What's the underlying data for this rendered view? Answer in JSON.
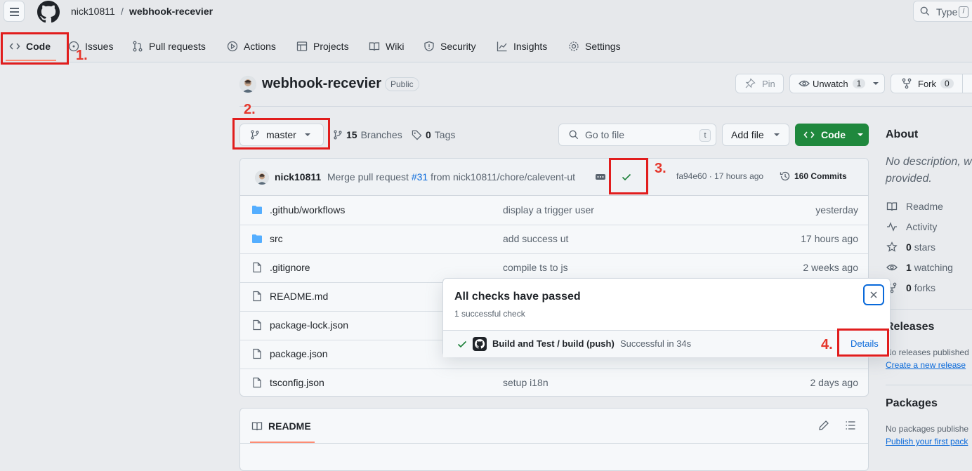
{
  "header": {
    "owner": "nick10811",
    "separator": "/",
    "repo": "webhook-recevier",
    "search_placeholder": "Type",
    "search_kbd": "/"
  },
  "tabs": [
    {
      "label": "Code",
      "icon": "code-icon"
    },
    {
      "label": "Issues",
      "icon": "issue-icon"
    },
    {
      "label": "Pull requests",
      "icon": "pull-request-icon"
    },
    {
      "label": "Actions",
      "icon": "play-icon"
    },
    {
      "label": "Projects",
      "icon": "table-icon"
    },
    {
      "label": "Wiki",
      "icon": "book-icon"
    },
    {
      "label": "Security",
      "icon": "shield-icon"
    },
    {
      "label": "Insights",
      "icon": "graph-icon"
    },
    {
      "label": "Settings",
      "icon": "gear-icon"
    }
  ],
  "annotations": {
    "step1": "1.",
    "step2": "2.",
    "step3": "3.",
    "step4": "4."
  },
  "repo": {
    "title": "webhook-recevier",
    "visibility": "Public",
    "pin_label": "Pin",
    "unwatch_label": "Unwatch",
    "watch_count": "1",
    "fork_label": "Fork",
    "fork_count": "0"
  },
  "branchbar": {
    "branch": "master",
    "branches_count": "15",
    "branches_label": "Branches",
    "tags_count": "0",
    "tags_label": "Tags",
    "goto_placeholder": "Go to file",
    "goto_kbd": "t",
    "addfile_label": "Add file",
    "code_label": "Code"
  },
  "commit": {
    "author": "nick10811",
    "message_prefix": "Merge pull request",
    "pr_link": "#31",
    "message_suffix": "from nick10811/chore/calevent-ut",
    "hash_time": "fa94e60 · 17 hours ago",
    "commits_label": "160 Commits"
  },
  "files": [
    {
      "type": "dir",
      "name": ".github/workflows",
      "message": "display a trigger user",
      "date": "yesterday"
    },
    {
      "type": "dir",
      "name": "src",
      "message": "add success ut",
      "date": "17 hours ago"
    },
    {
      "type": "file",
      "name": ".gitignore",
      "message": "compile ts to js",
      "date": "2 weeks ago"
    },
    {
      "type": "file",
      "name": "README.md",
      "message": "",
      "date": ""
    },
    {
      "type": "file",
      "name": "package-lock.json",
      "message": "",
      "date": ""
    },
    {
      "type": "file",
      "name": "package.json",
      "message": "",
      "date": ""
    },
    {
      "type": "file",
      "name": "tsconfig.json",
      "message": "setup i18n",
      "date": "2 days ago"
    }
  ],
  "readme": {
    "label": "README"
  },
  "popup": {
    "title": "All checks have passed",
    "subtitle": "1 successful check",
    "check_name": "Build and Test / build (push)",
    "check_status": "Successful in 34s",
    "details_label": "Details"
  },
  "sidebar": {
    "about_heading": "About",
    "about_desc_line1": "No description, w",
    "about_desc_line2": "provided.",
    "readme": "Readme",
    "activity": "Activity",
    "stars_count": "0",
    "stars_label": "stars",
    "watching_count": "1",
    "watching_label": "watching",
    "forks_count": "0",
    "forks_label": "forks",
    "releases_heading": "Releases",
    "releases_text": "No releases published",
    "releases_link": "Create a new release",
    "packages_heading": "Packages",
    "packages_text": "No packages publishe",
    "packages_link": "Publish your first pack"
  },
  "colors": {
    "accent_green": "#1f883d",
    "link_blue": "#0969da",
    "annotation_red": "#e11d1d",
    "folder_blue": "#54aeff"
  }
}
